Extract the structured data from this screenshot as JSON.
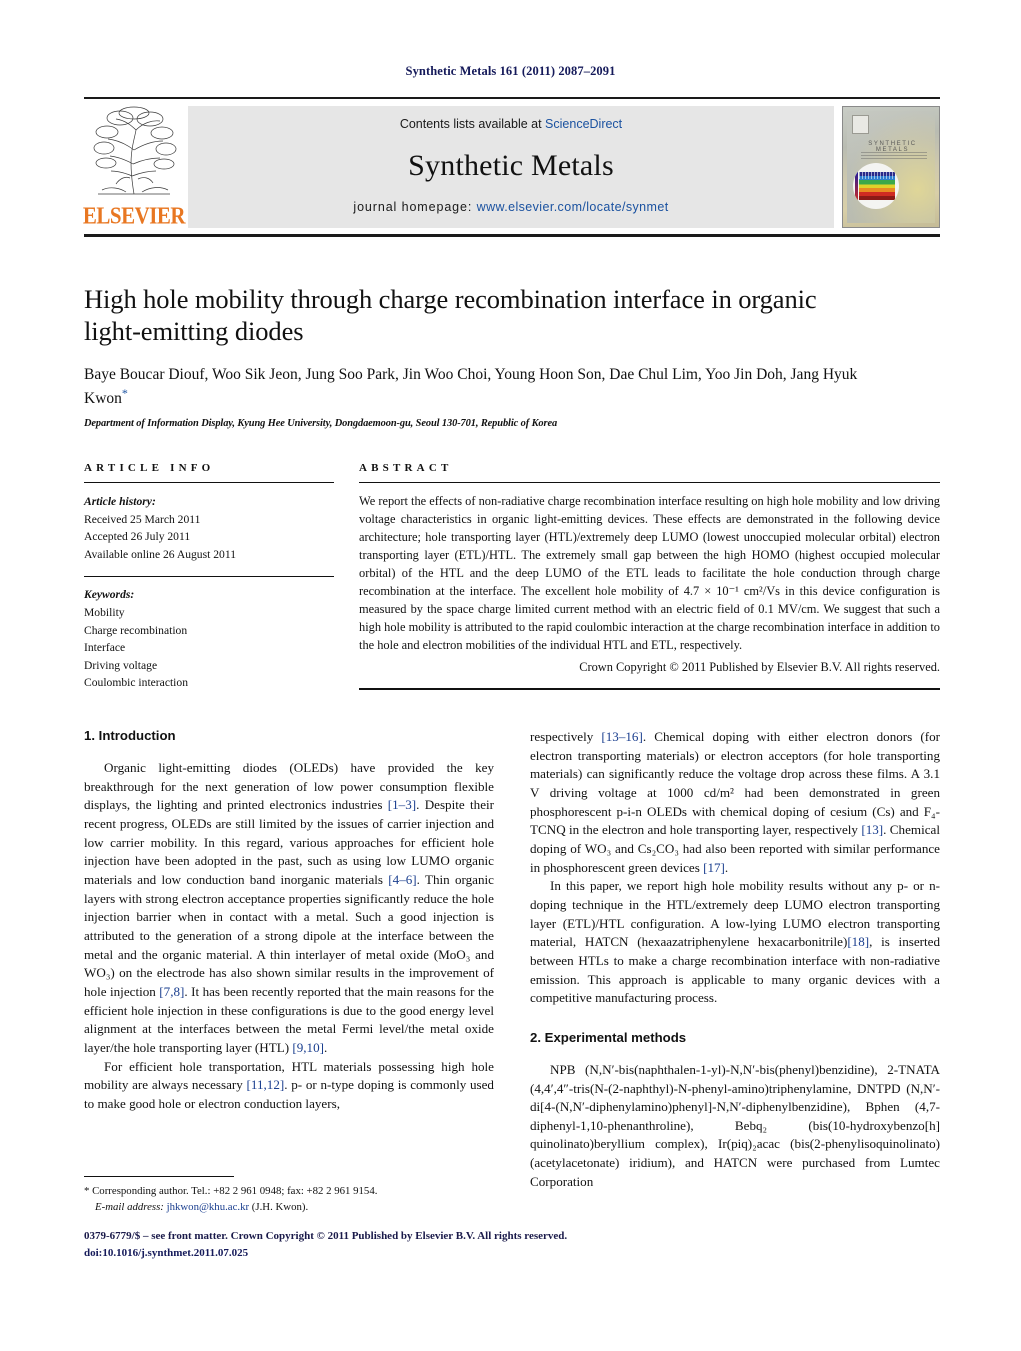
{
  "running_head": "Synthetic Metals 161 (2011) 2087–2091",
  "masthead": {
    "contents_prefix": "Contents lists available at ",
    "contents_link": "ScienceDirect",
    "journal_name": "Synthetic Metals",
    "homepage_prefix": "journal homepage: ",
    "homepage_url": "www.elsevier.com/locate/synmet",
    "publisher": "ELSEVIER",
    "cover_title": "SYNTHETIC METALS"
  },
  "article": {
    "title": "High hole mobility through charge recombination interface in organic light-emitting diodes",
    "authors": "Baye Boucar Diouf, Woo Sik Jeon, Jung Soo Park, Jin Woo Choi, Young Hoon Son, Dae Chul Lim, Yoo Jin Doh, Jang Hyuk Kwon",
    "author_marker": "*",
    "affiliation": "Department of Information Display, Kyung Hee University, Dongdaemoon-gu, Seoul 130-701, Republic of Korea"
  },
  "info": {
    "heading": "ARTICLE INFO",
    "history_label": "Article history:",
    "history": [
      "Received 25 March 2011",
      "Accepted 26 July 2011",
      "Available online 26 August 2011"
    ],
    "keywords_label": "Keywords:",
    "keywords": [
      "Mobility",
      "Charge recombination",
      "Interface",
      "Driving voltage",
      "Coulombic interaction"
    ]
  },
  "abstract": {
    "heading": "ABSTRACT",
    "text": "We report the effects of non-radiative charge recombination interface resulting on high hole mobility and low driving voltage characteristics in organic light-emitting devices. These effects are demonstrated in the following device architecture; hole transporting layer (HTL)/extremely deep LUMO (lowest unoccupied molecular orbital) electron transporting layer (ETL)/HTL. The extremely small gap between the high HOMO (highest occupied molecular orbital) of the HTL and the deep LUMO of the ETL leads to facilitate the hole conduction through charge recombination at the interface. The excellent hole mobility of 4.7 × 10⁻¹ cm²/Vs in this device configuration is measured by the space charge limited current method with an electric field of 0.1 MV/cm. We suggest that such a high hole mobility is attributed to the rapid coulombic interaction at the charge recombination interface in addition to the hole and electron mobilities of the individual HTL and ETL, respectively.",
    "copyright": "Crown Copyright © 2011 Published by Elsevier B.V. All rights reserved."
  },
  "body": {
    "section1_title": "1. Introduction",
    "section1_paragraphs": [
      "Organic light-emitting diodes (OLEDs) have provided the key breakthrough for the next generation of low power consumption flexible displays, the lighting and printed electronics industries [1–3]. Despite their recent progress, OLEDs are still limited by the issues of carrier injection and low carrier mobility. In this regard, various approaches for efficient hole injection have been adopted in the past, such as using low LUMO organic materials and low conduction band inorganic materials [4–6]. Thin organic layers with strong electron acceptance properties significantly reduce the hole injection barrier when in contact with a metal. Such a good injection is attributed to the generation of a strong dipole at the interface between the metal and the organic material. A thin interlayer of metal oxide (MoO₃ and WO₃) on the electrode has also shown similar results in the improvement of hole injection [7,8]. It has been recently reported that the main reasons for the efficient hole injection in these configurations is due to the good energy level alignment at the interfaces between the metal Fermi level/the metal oxide layer/the hole transporting layer (HTL) [9,10].",
      "For efficient hole transportation, HTL materials possessing high hole mobility are always necessary [11,12]. p- or n-type doping is commonly used to make good hole or electron conduction layers,",
      "respectively [13–16]. Chemical doping with either electron donors (for electron transporting materials) or electron acceptors (for hole transporting materials) can significantly reduce the voltage drop across these films. A 3.1 V driving voltage at 1000 cd/m² had been demonstrated in green phosphorescent p-i-n OLEDs with chemical doping of cesium (Cs) and F₄-TCNQ in the electron and hole transporting layer, respectively [13]. Chemical doping of WO₃ and Cs₂CO₃ had also been reported with similar performance in phosphorescent green devices [17].",
      "In this paper, we report high hole mobility results without any p- or n-doping technique in the HTL/extremely deep LUMO electron transporting layer (ETL)/HTL configuration. A low-lying LUMO electron transporting material, HATCN (hexaazatriphenylene hexacarbonitrile)[18], is inserted between HTLs to make a charge recombination interface with non-radiative emission. This approach is applicable to many organic devices with a competitive manufacturing process."
    ],
    "section2_title": "2. Experimental methods",
    "section2_paragraphs": [
      "NPB (N,N′-bis(naphthalen-1-yl)-N,N′-bis(phenyl)benzidine), 2-TNATA (4,4′,4″-tris(N-(2-naphthyl)-N-phenyl-amino)triphenylamine, DNTPD (N,N′-di[4-(N,N′-diphenylamino)phenyl]-N,N′-diphenylbenzidine), Bphen (4,7-diphenyl-1,10-phenanthroline), Bebq₂ (bis(10-hydroxybenzo[h] quinolinato)beryllium complex), Ir(piq)₂acac (bis(2-phenylisoquinolinato) (acetylacetonate) iridium), and HATCN were purchased from Lumtec Corporation"
    ]
  },
  "footnote": {
    "marker": "*",
    "corresponding": "Corresponding author. Tel.: +82 2 961 0948; fax: +82 2 961 9154.",
    "email_label": "E-mail address:",
    "email": "jhkwon@khu.ac.kr",
    "email_owner": "(J.H. Kwon)."
  },
  "imprint": {
    "line1": "0379-6779/$ – see front matter. Crown Copyright © 2011 Published by Elsevier B.V. All rights reserved.",
    "line2": "doi:10.1016/j.synthmet.2011.07.025"
  },
  "colors": {
    "link_blue": "#1b52a0",
    "ref_blue": "#1b3f8f",
    "elsevier_orange": "#E87722",
    "running_head": "#151a5a"
  }
}
